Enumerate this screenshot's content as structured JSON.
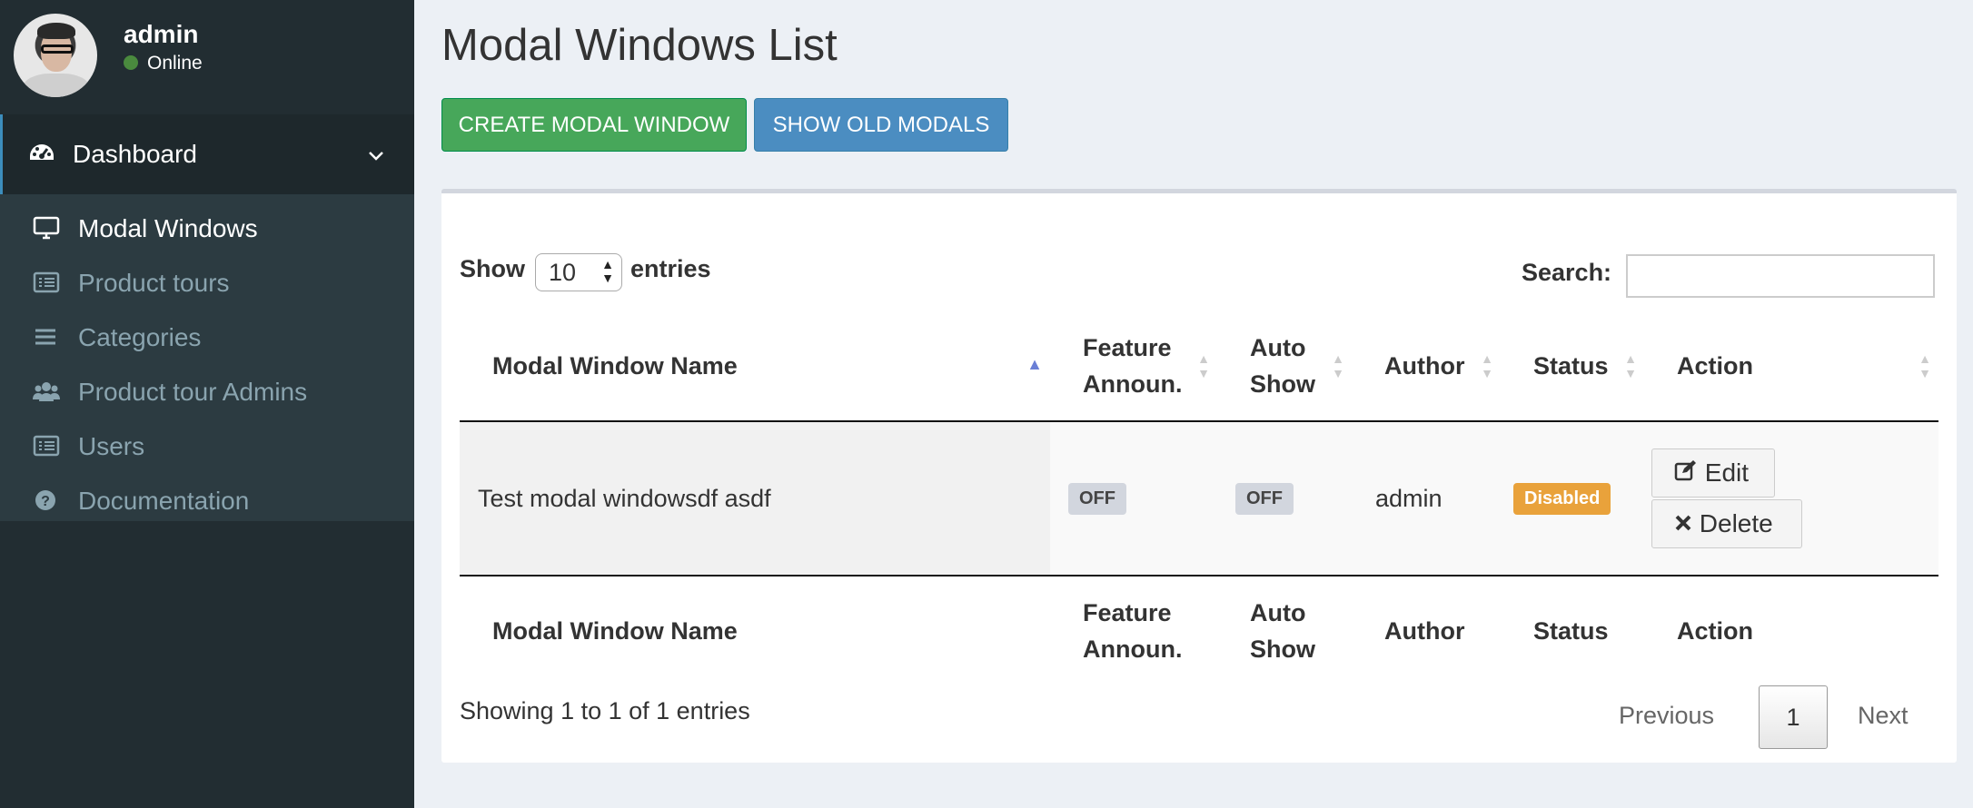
{
  "user": {
    "name": "admin",
    "status": "Online"
  },
  "sidebar": {
    "dashboard": {
      "label": "Dashboard",
      "icon": "dashboard-icon"
    },
    "items": [
      {
        "label": "Modal Windows",
        "icon": "desktop-icon",
        "active": true
      },
      {
        "label": "Product tours",
        "icon": "list-alt-icon",
        "active": false
      },
      {
        "label": "Categories",
        "icon": "bars-icon",
        "active": false
      },
      {
        "label": "Product tour Admins",
        "icon": "users-icon",
        "active": false
      },
      {
        "label": "Users",
        "icon": "list-alt-icon",
        "active": false
      },
      {
        "label": "Documentation",
        "icon": "question-circle-icon",
        "active": false
      }
    ]
  },
  "page": {
    "title": "Modal Windows List",
    "create_button": "CREATE MODAL WINDOW",
    "old_button": "SHOW OLD MODALS"
  },
  "table": {
    "length_prefix": "Show",
    "length_value": "10",
    "length_suffix": "entries",
    "search_label": "Search:",
    "search_value": "",
    "columns": [
      "Modal Window Name",
      "Feature Announ.",
      "Auto Show",
      "Author",
      "Status",
      "Action"
    ],
    "rows": [
      {
        "name": "Test modal windowsdf asdf",
        "feature": "OFF",
        "auto_show": "OFF",
        "author": "admin",
        "status": "Disabled",
        "edit": "Edit",
        "delete": "Delete"
      }
    ],
    "info": "Showing 1 to 1 of 1 entries",
    "pagination": {
      "previous": "Previous",
      "page": "1",
      "next": "Next"
    }
  },
  "colors": {
    "sidebar_bg": "#222d32",
    "create_button": "#47a75a",
    "old_button": "#4b8dc1",
    "disabled_badge": "#e9a23b"
  }
}
